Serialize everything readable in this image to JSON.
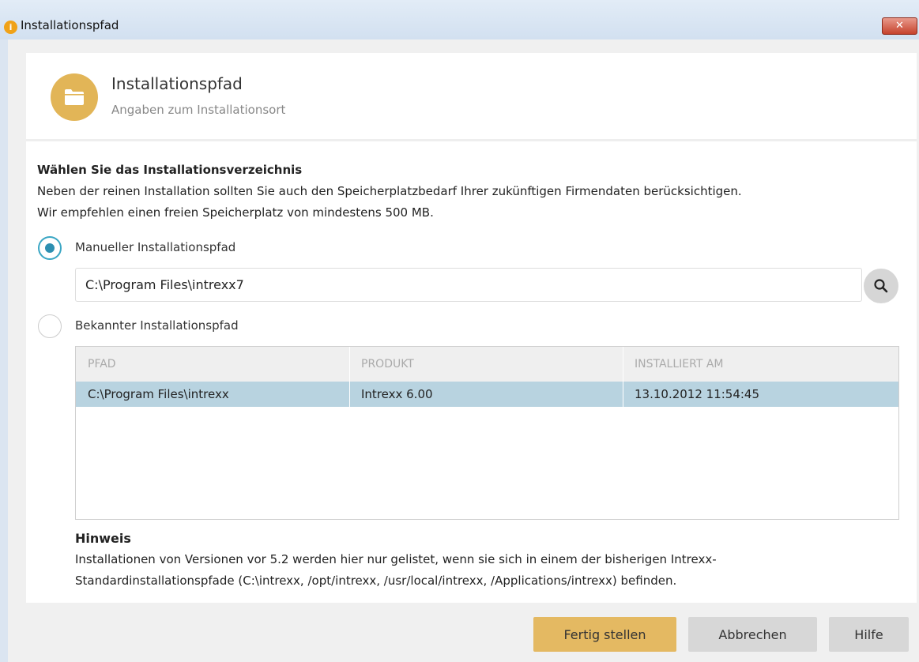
{
  "window": {
    "title": "Installationspfad",
    "close_glyph": "✕",
    "app_icon_glyph": "i"
  },
  "header": {
    "title": "Installationspfad",
    "subtitle": "Angaben zum Installationsort",
    "icon": "folder-icon",
    "icon_color": "#e2b557"
  },
  "section": {
    "title": "Wählen Sie das Installationsverzeichnis",
    "line1": "Neben der reinen Installation sollten Sie auch den Speicherplatzbedarf Ihrer zukünftigen Firmendaten berücksichtigen.",
    "line2": "Wir empfehlen einen freien Speicherplatz von mindestens 500 MB."
  },
  "options": {
    "manual": {
      "label": "Manueller Installationspfad",
      "selected": true
    },
    "known": {
      "label": "Bekannter Installationspfad",
      "selected": false
    }
  },
  "path_input": {
    "value": "C:\\Program Files\\intrexx7"
  },
  "table": {
    "columns": [
      "PFAD",
      "PRODUKT",
      "INSTALLIERT AM"
    ],
    "rows": [
      {
        "path": "C:\\Program Files\\intrexx",
        "product": "Intrexx 6.00",
        "installed": "13.10.2012 11:54:45",
        "selected": true
      }
    ]
  },
  "hint": {
    "title": "Hinweis",
    "line1": "Installationen von Versionen vor 5.2 werden hier nur gelistet, wenn sie sich in einem der bisherigen Intrexx-",
    "line2": "Standardinstallationspfade (C:\\intrexx, /opt/intrexx, /usr/local/intrexx, /Applications/intrexx) befinden."
  },
  "buttons": {
    "finish": "Fertig stellen",
    "cancel": "Abbrechen",
    "help": "Hilfe"
  },
  "colors": {
    "accent": "#e2b557",
    "selection": "#b8d3e0",
    "radio_active": "#2d8fb1"
  }
}
